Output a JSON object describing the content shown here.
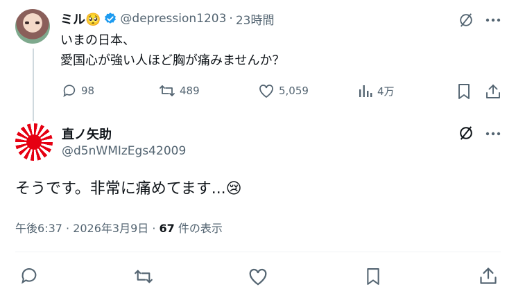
{
  "parent_tweet": {
    "display_name": "ミル🥺",
    "handle": "@depression1203",
    "separator": "·",
    "time": "23時間",
    "text_line1": "いまの日本、",
    "text_line2": "愛国心が強い人ほど胸が痛みませんか？",
    "stats": {
      "replies": "98",
      "retweets": "489",
      "likes": "5,059",
      "views": "4万"
    }
  },
  "reply_tweet": {
    "display_name": "直ノ矢助",
    "handle": "@d5nWMIzEgs42009",
    "text": "そうです。非常に痛めてます...😢",
    "timestamp": "午後6:37 · 2026年3月9日 · ",
    "views_count": "67",
    "views_label": " 件の表示"
  },
  "colors": {
    "accent": "#1d9bf0",
    "muted": "#536471",
    "verified": "#1d9bf0",
    "flag_red": "#e60012"
  }
}
